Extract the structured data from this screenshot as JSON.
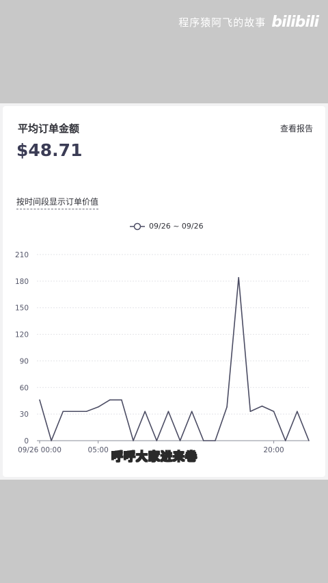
{
  "watermark": {
    "channel": "程序猿阿飞的故事",
    "logo": "bilibili"
  },
  "card": {
    "title": "平均订单金额",
    "report_link": "查看报告",
    "value": "$48.71",
    "section_label": "按时间段显示订单价值",
    "legend_label": "09/26 ~ 09/26"
  },
  "chart_data": {
    "type": "line",
    "series": [
      {
        "name": "09/26 ~ 09/26",
        "values": [
          46,
          0,
          33,
          33,
          33,
          38,
          46,
          46,
          0,
          33,
          0,
          33,
          0,
          33,
          0,
          0,
          38,
          184,
          33,
          39,
          33,
          0,
          33,
          0
        ]
      }
    ],
    "x": [
      0,
      1,
      2,
      3,
      4,
      5,
      6,
      7,
      8,
      9,
      10,
      11,
      12,
      13,
      14,
      15,
      16,
      17,
      18,
      19,
      20,
      21,
      22,
      23
    ],
    "x_tick_labels": [
      {
        "x": 0,
        "label": "09/26 00:00"
      },
      {
        "x": 5,
        "label": "05:00"
      },
      {
        "x": 20,
        "label": "20:00"
      }
    ],
    "y_ticks": [
      0,
      30,
      60,
      90,
      120,
      150,
      180,
      210
    ],
    "ylim": [
      0,
      210
    ],
    "grid": true,
    "line_color": "#4b4c63"
  },
  "subtitle": "呼呼大家进来卷"
}
